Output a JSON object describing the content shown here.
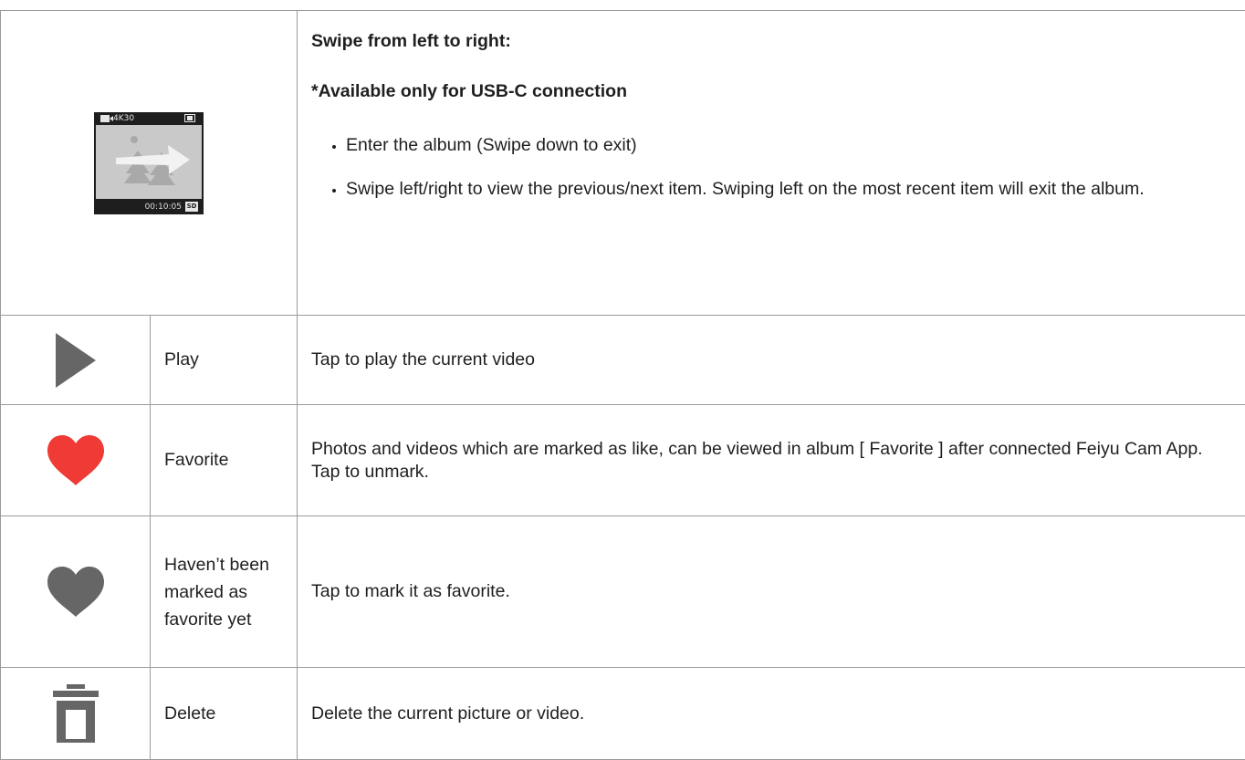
{
  "swipe": {
    "heading": "Swipe from left to right:",
    "subheading": "*Available only for USB-C connection",
    "bullets": [
      "Enter the album (Swipe down to exit)",
      "Swipe left/right to view the previous/next item. Swiping left on the most recent item will exit the album."
    ],
    "screen": {
      "resolution": "4K30",
      "timecode": "00:10:05",
      "storage_badge": "SD",
      "icons": [
        "video-mode-icon",
        "battery-icon",
        "swipe-right-arrow-icon",
        "sd-card-icon"
      ]
    }
  },
  "rows": [
    {
      "icon": "play-icon",
      "icon_color": "#666666",
      "name": "Play",
      "description": "Tap to play the current video"
    },
    {
      "icon": "heart-filled-icon",
      "icon_color": "#ef3a35",
      "name": "Favorite",
      "description_lines": [
        "Photos and videos which are marked as like, can be viewed in album [ Favorite ] after connected Feiyu Cam App.",
        "Tap to unmark."
      ]
    },
    {
      "icon": "heart-outline-icon",
      "icon_color": "#666666",
      "name": "Haven’t been marked as favorite yet",
      "description": "Tap to mark it as favorite."
    },
    {
      "icon": "trash-icon",
      "icon_color": "#666666",
      "name": "Delete",
      "description": "Delete the current picture or video."
    }
  ]
}
